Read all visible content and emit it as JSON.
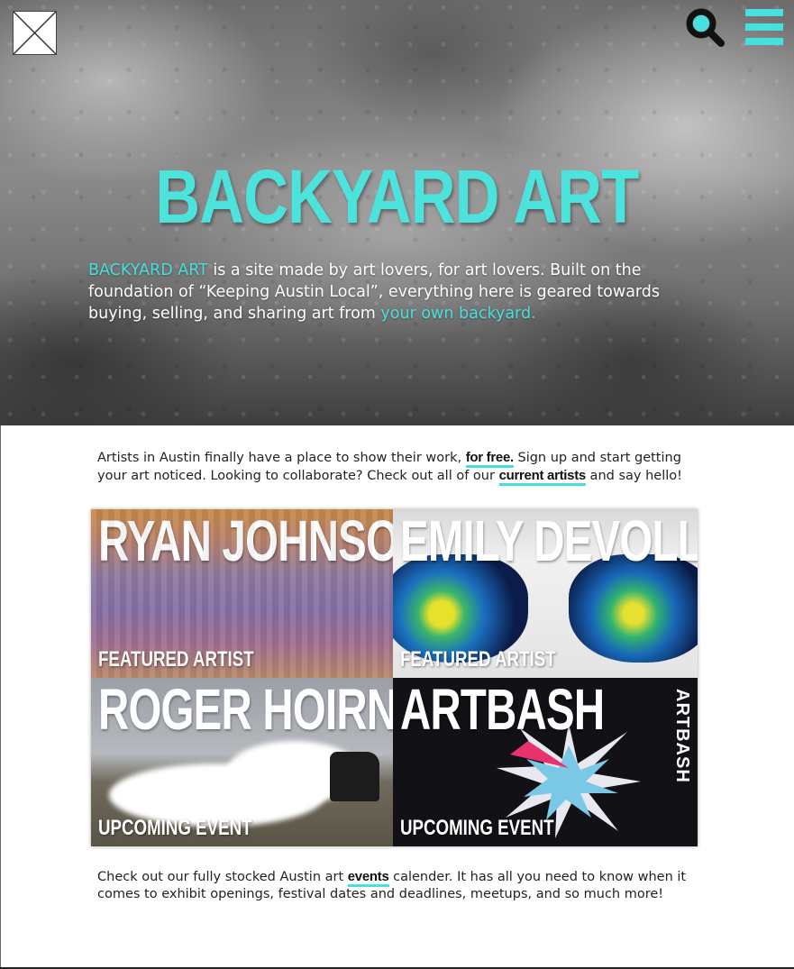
{
  "header": {
    "logo_icon": "placeholder-image-icon",
    "search_icon": "search-icon",
    "menu_icon": "hamburger-menu-icon",
    "accent_color": "#48e0de"
  },
  "hero": {
    "title": "BACKYARD ART",
    "text_brand": "BACKYARD ART",
    "text_body": " is a site made by art lovers, for art lovers. Built on the foundation of “Keeping Austin Local”, everything here is geared towards buying, selling, and sharing art from ",
    "text_link": "your own backyard."
  },
  "intro": {
    "part1": "Artists in Austin finally have a place to show their work, ",
    "link1": "for free.",
    "part2": " Sign up and start getting your art noticed. Looking to collaborate? Check out all of our ",
    "link2": "current artists",
    "part3": " and say hello!"
  },
  "tiles": [
    {
      "name": "RYAN JOHNSON",
      "tag": "FEATURED ARTIST"
    },
    {
      "name": "EMILY DEVOLL",
      "tag": "FEATURED ARTIST"
    },
    {
      "name": "ROGER HOIRNS",
      "tag": "UPCOMING EVENT"
    },
    {
      "name": "ARTBASH",
      "tag": "UPCOMING EVENT",
      "vertical_label": "ARTBASH"
    }
  ],
  "outro": {
    "part1": "Check out our fully stocked Austin art ",
    "link": "events",
    "part2": " calender. It has all you need to know when it comes to exhibit openings, festival dates and deadlines, meetups, and so much more!"
  }
}
